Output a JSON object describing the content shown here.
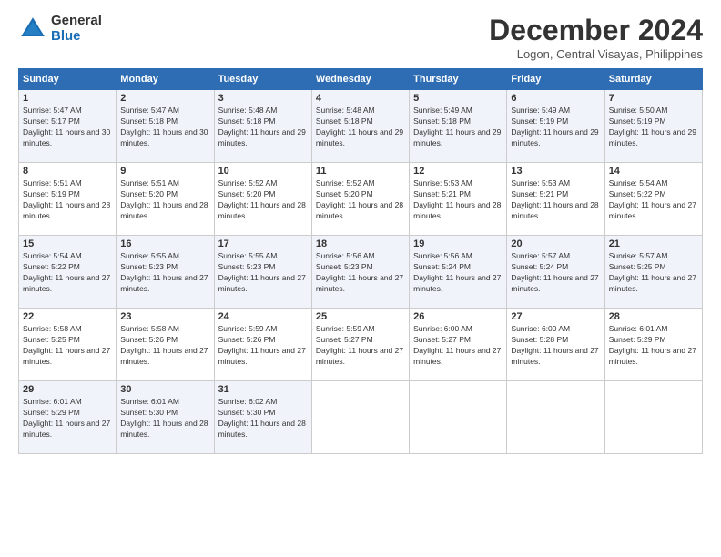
{
  "header": {
    "logo_general": "General",
    "logo_blue": "Blue",
    "month": "December 2024",
    "location": "Logon, Central Visayas, Philippines"
  },
  "weekdays": [
    "Sunday",
    "Monday",
    "Tuesday",
    "Wednesday",
    "Thursday",
    "Friday",
    "Saturday"
  ],
  "weeks": [
    [
      {
        "day": "1",
        "sunrise": "Sunrise: 5:47 AM",
        "sunset": "Sunset: 5:17 PM",
        "daylight": "Daylight: 11 hours and 30 minutes."
      },
      {
        "day": "2",
        "sunrise": "Sunrise: 5:47 AM",
        "sunset": "Sunset: 5:18 PM",
        "daylight": "Daylight: 11 hours and 30 minutes."
      },
      {
        "day": "3",
        "sunrise": "Sunrise: 5:48 AM",
        "sunset": "Sunset: 5:18 PM",
        "daylight": "Daylight: 11 hours and 29 minutes."
      },
      {
        "day": "4",
        "sunrise": "Sunrise: 5:48 AM",
        "sunset": "Sunset: 5:18 PM",
        "daylight": "Daylight: 11 hours and 29 minutes."
      },
      {
        "day": "5",
        "sunrise": "Sunrise: 5:49 AM",
        "sunset": "Sunset: 5:18 PM",
        "daylight": "Daylight: 11 hours and 29 minutes."
      },
      {
        "day": "6",
        "sunrise": "Sunrise: 5:49 AM",
        "sunset": "Sunset: 5:19 PM",
        "daylight": "Daylight: 11 hours and 29 minutes."
      },
      {
        "day": "7",
        "sunrise": "Sunrise: 5:50 AM",
        "sunset": "Sunset: 5:19 PM",
        "daylight": "Daylight: 11 hours and 29 minutes."
      }
    ],
    [
      {
        "day": "8",
        "sunrise": "Sunrise: 5:51 AM",
        "sunset": "Sunset: 5:19 PM",
        "daylight": "Daylight: 11 hours and 28 minutes."
      },
      {
        "day": "9",
        "sunrise": "Sunrise: 5:51 AM",
        "sunset": "Sunset: 5:20 PM",
        "daylight": "Daylight: 11 hours and 28 minutes."
      },
      {
        "day": "10",
        "sunrise": "Sunrise: 5:52 AM",
        "sunset": "Sunset: 5:20 PM",
        "daylight": "Daylight: 11 hours and 28 minutes."
      },
      {
        "day": "11",
        "sunrise": "Sunrise: 5:52 AM",
        "sunset": "Sunset: 5:20 PM",
        "daylight": "Daylight: 11 hours and 28 minutes."
      },
      {
        "day": "12",
        "sunrise": "Sunrise: 5:53 AM",
        "sunset": "Sunset: 5:21 PM",
        "daylight": "Daylight: 11 hours and 28 minutes."
      },
      {
        "day": "13",
        "sunrise": "Sunrise: 5:53 AM",
        "sunset": "Sunset: 5:21 PM",
        "daylight": "Daylight: 11 hours and 28 minutes."
      },
      {
        "day": "14",
        "sunrise": "Sunrise: 5:54 AM",
        "sunset": "Sunset: 5:22 PM",
        "daylight": "Daylight: 11 hours and 27 minutes."
      }
    ],
    [
      {
        "day": "15",
        "sunrise": "Sunrise: 5:54 AM",
        "sunset": "Sunset: 5:22 PM",
        "daylight": "Daylight: 11 hours and 27 minutes."
      },
      {
        "day": "16",
        "sunrise": "Sunrise: 5:55 AM",
        "sunset": "Sunset: 5:23 PM",
        "daylight": "Daylight: 11 hours and 27 minutes."
      },
      {
        "day": "17",
        "sunrise": "Sunrise: 5:55 AM",
        "sunset": "Sunset: 5:23 PM",
        "daylight": "Daylight: 11 hours and 27 minutes."
      },
      {
        "day": "18",
        "sunrise": "Sunrise: 5:56 AM",
        "sunset": "Sunset: 5:23 PM",
        "daylight": "Daylight: 11 hours and 27 minutes."
      },
      {
        "day": "19",
        "sunrise": "Sunrise: 5:56 AM",
        "sunset": "Sunset: 5:24 PM",
        "daylight": "Daylight: 11 hours and 27 minutes."
      },
      {
        "day": "20",
        "sunrise": "Sunrise: 5:57 AM",
        "sunset": "Sunset: 5:24 PM",
        "daylight": "Daylight: 11 hours and 27 minutes."
      },
      {
        "day": "21",
        "sunrise": "Sunrise: 5:57 AM",
        "sunset": "Sunset: 5:25 PM",
        "daylight": "Daylight: 11 hours and 27 minutes."
      }
    ],
    [
      {
        "day": "22",
        "sunrise": "Sunrise: 5:58 AM",
        "sunset": "Sunset: 5:25 PM",
        "daylight": "Daylight: 11 hours and 27 minutes."
      },
      {
        "day": "23",
        "sunrise": "Sunrise: 5:58 AM",
        "sunset": "Sunset: 5:26 PM",
        "daylight": "Daylight: 11 hours and 27 minutes."
      },
      {
        "day": "24",
        "sunrise": "Sunrise: 5:59 AM",
        "sunset": "Sunset: 5:26 PM",
        "daylight": "Daylight: 11 hours and 27 minutes."
      },
      {
        "day": "25",
        "sunrise": "Sunrise: 5:59 AM",
        "sunset": "Sunset: 5:27 PM",
        "daylight": "Daylight: 11 hours and 27 minutes."
      },
      {
        "day": "26",
        "sunrise": "Sunrise: 6:00 AM",
        "sunset": "Sunset: 5:27 PM",
        "daylight": "Daylight: 11 hours and 27 minutes."
      },
      {
        "day": "27",
        "sunrise": "Sunrise: 6:00 AM",
        "sunset": "Sunset: 5:28 PM",
        "daylight": "Daylight: 11 hours and 27 minutes."
      },
      {
        "day": "28",
        "sunrise": "Sunrise: 6:01 AM",
        "sunset": "Sunset: 5:29 PM",
        "daylight": "Daylight: 11 hours and 27 minutes."
      }
    ],
    [
      {
        "day": "29",
        "sunrise": "Sunrise: 6:01 AM",
        "sunset": "Sunset: 5:29 PM",
        "daylight": "Daylight: 11 hours and 27 minutes."
      },
      {
        "day": "30",
        "sunrise": "Sunrise: 6:01 AM",
        "sunset": "Sunset: 5:30 PM",
        "daylight": "Daylight: 11 hours and 28 minutes."
      },
      {
        "day": "31",
        "sunrise": "Sunrise: 6:02 AM",
        "sunset": "Sunset: 5:30 PM",
        "daylight": "Daylight: 11 hours and 28 minutes."
      },
      null,
      null,
      null,
      null
    ]
  ]
}
